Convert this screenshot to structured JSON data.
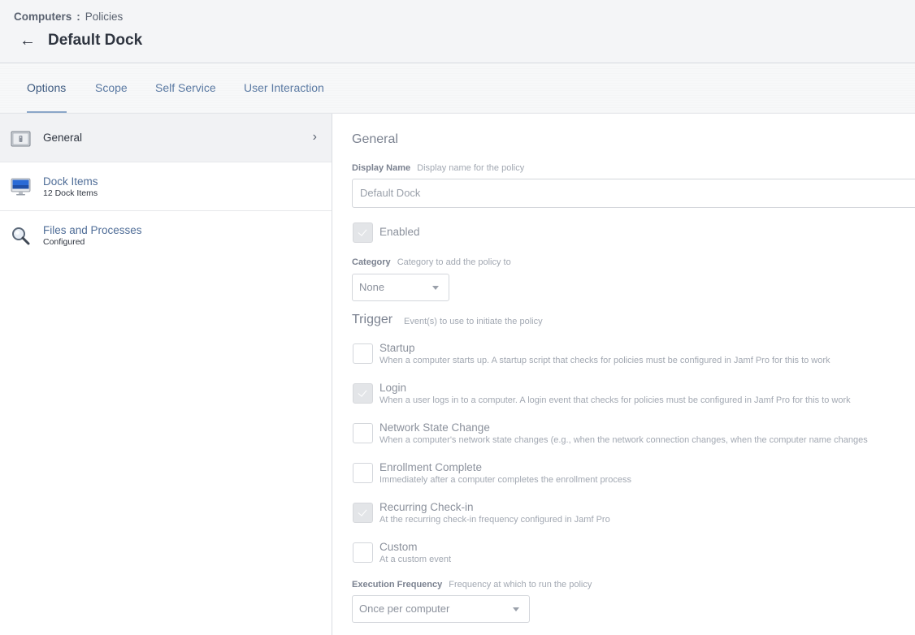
{
  "breadcrumb": {
    "root": "Computers",
    "separator": ":",
    "current": "Policies"
  },
  "header": {
    "back_icon": "←",
    "title": "Default Dock"
  },
  "tabs": [
    {
      "label": "Options",
      "active": true
    },
    {
      "label": "Scope",
      "active": false
    },
    {
      "label": "Self Service",
      "active": false
    },
    {
      "label": "User Interaction",
      "active": false
    }
  ],
  "sidebar": {
    "items": [
      {
        "label": "General",
        "subtitle": "",
        "icon": "general-icon",
        "active": true,
        "chevron": "›"
      },
      {
        "label": "Dock Items",
        "subtitle": "12 Dock Items",
        "icon": "monitor-icon",
        "active": false
      },
      {
        "label": "Files and Processes",
        "subtitle": "Configured",
        "icon": "magnifier-icon",
        "active": false
      }
    ]
  },
  "general": {
    "title": "General",
    "display_name": {
      "label": "Display Name",
      "hint": "Display name for the policy",
      "value": "Default Dock"
    },
    "enabled": {
      "label": "Enabled",
      "checked": true
    },
    "category": {
      "label": "Category",
      "hint": "Category to add the policy to",
      "value": "None"
    },
    "trigger": {
      "title": "Trigger",
      "hint": "Event(s) to use to initiate the policy",
      "options": [
        {
          "label": "Startup",
          "desc": "When a computer starts up. A startup script that checks for policies must be configured in Jamf Pro for this to work",
          "checked": false
        },
        {
          "label": "Login",
          "desc": "When a user logs in to a computer. A login event that checks for policies must be configured in Jamf Pro for this to work",
          "checked": true
        },
        {
          "label": "Network State Change",
          "desc": "When a computer's network state changes (e.g., when the network connection changes, when the computer name changes",
          "checked": false
        },
        {
          "label": "Enrollment Complete",
          "desc": "Immediately after a computer completes the enrollment process",
          "checked": false
        },
        {
          "label": "Recurring Check-in",
          "desc": "At the recurring check-in frequency configured in Jamf Pro",
          "checked": true
        },
        {
          "label": "Custom",
          "desc": "At a custom event",
          "checked": false
        }
      ]
    },
    "execution_frequency": {
      "label": "Execution Frequency",
      "hint": "Frequency at which to run the policy",
      "value": "Once per computer"
    }
  }
}
